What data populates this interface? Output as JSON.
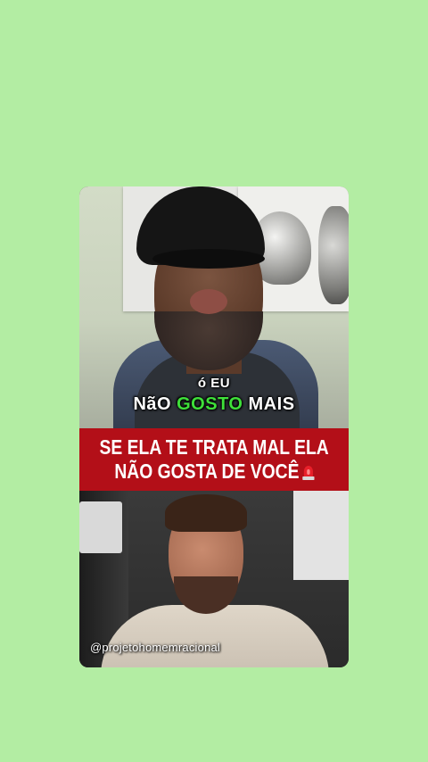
{
  "subtitle": {
    "line1": "ó EU",
    "line2_pre": "NãO ",
    "line2_highlight": "GOSTO",
    "line2_post": " MAIS"
  },
  "banner": {
    "line1": "SE ELA TE TRATA MAL ELA",
    "line2": "NÃO GOSTA DE VOCÊ",
    "icon": "siren-icon"
  },
  "watermark": "@projetohomemracional",
  "colors": {
    "page_background": "#b3eda3",
    "banner_red": "#b30f18",
    "subtitle_highlight": "#3fe03a"
  }
}
